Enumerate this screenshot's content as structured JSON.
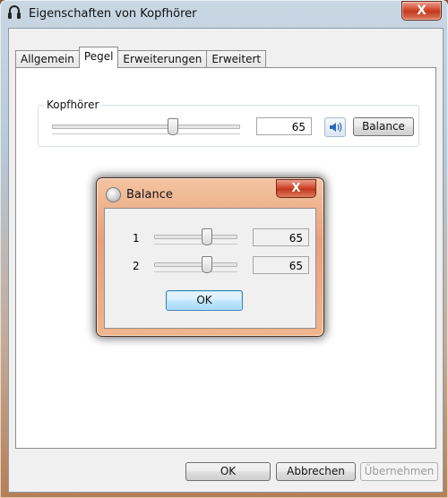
{
  "window": {
    "title": "Eigenschaften von Kopfhörer",
    "icon": "headphones-icon",
    "close_glyph": "X"
  },
  "tabs": [
    {
      "label": "Allgemein",
      "active": false
    },
    {
      "label": "Pegel",
      "active": true
    },
    {
      "label": "Erweiterungen",
      "active": false
    },
    {
      "label": "Erweitert",
      "active": false
    }
  ],
  "level": {
    "group_label": "Kopfhörer",
    "value": "65",
    "slider_fraction": 0.65,
    "mute_icon": "speaker-icon",
    "balance_button": "Balance"
  },
  "balance_dialog": {
    "title": "Balance",
    "close_glyph": "X",
    "channels": [
      {
        "label": "1",
        "value": "65",
        "slider_fraction": 0.65
      },
      {
        "label": "2",
        "value": "65",
        "slider_fraction": 0.65
      }
    ],
    "ok_button": "OK"
  },
  "footer": {
    "ok": "OK",
    "cancel": "Abbrechen",
    "apply": "Übernehmen"
  },
  "colors": {
    "aero_accent": "#c9d7e3",
    "close_red": "#d2472b",
    "dialog_glass": "#e9a07a"
  }
}
